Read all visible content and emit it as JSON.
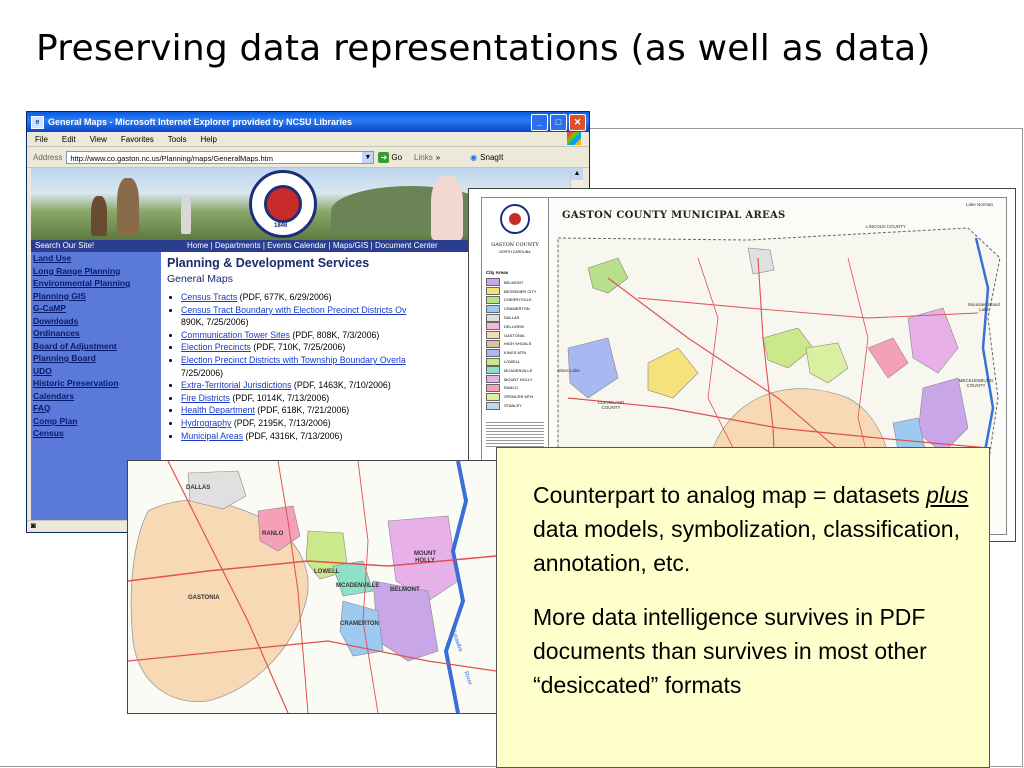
{
  "slide": {
    "title": "Preserving data representations (as well as data)"
  },
  "browser": {
    "window_title": "General Maps - Microsoft Internet Explorer provided by NCSU Libraries",
    "menu": [
      "File",
      "Edit",
      "View",
      "Favorites",
      "Tools",
      "Help"
    ],
    "address_label": "Address",
    "address_value": "http://www.co.gaston.nc.us/Planning/maps/GeneralMaps.htm",
    "go_label": "Go",
    "links_label": "Links",
    "snagit_label": "SnagIt"
  },
  "website": {
    "search_label": "Search Our Site!",
    "top_links": "Home | Departments | Events Calendar | Maps/GIS | Document Center",
    "seal_year": "1846",
    "nav_items": [
      "Land Use",
      "Long Range Planning",
      "Environmental Planning",
      "Planning GIS",
      "G-CaMP",
      "Downloads",
      "Ordinances",
      "Board of Adjustment",
      "Planning Board",
      "UDO",
      "Historic Preservation",
      "Calendars",
      "FAQ",
      "Comp Plan",
      "Census"
    ],
    "heading": "Planning & Development Services",
    "subheading": "General Maps",
    "maps": [
      {
        "link": "Census Tracts",
        "info": " (PDF, 677K, 6/29/2006)"
      },
      {
        "link": "Census Tract Boundary with Election Precinct Districts Ov",
        "info": "",
        "cont": "890K, 7/25/2006)"
      },
      {
        "link": "Communication Tower Sites",
        "info": " (PDF, 808K, 7/3/2006)"
      },
      {
        "link": "Election Precincts",
        "info": " (PDF, 710K, 7/25/2006)"
      },
      {
        "link": "Election Precinct Districts with Township Boundary Overla",
        "info": "",
        "cont": "7/25/2006)"
      },
      {
        "link": "Extra-Territorial Jurisdictions",
        "info": " (PDF, 1463K, 7/10/2006)"
      },
      {
        "link": "Fire Districts",
        "info": " (PDF, 1014K, 7/13/2006)"
      },
      {
        "link": "Health Department",
        "info": " (PDF, 618K, 7/21/2006)"
      },
      {
        "link": "Hydrography",
        "info": " (PDF, 2195K, 7/13/2006)"
      },
      {
        "link": "Municipal Areas",
        "info": " (PDF, 4316K, 7/13/2006)"
      }
    ]
  },
  "municipal_map": {
    "title": "GASTON COUNTY MUNICIPAL AREAS",
    "county_name": "GASTON COUNTY",
    "state": "NORTH CAROLINA",
    "legend_header": "City Areas",
    "legend": [
      {
        "name": "BELMONT",
        "color": "#c9a6e8"
      },
      {
        "name": "BESSEMER CITY",
        "color": "#f6e27a"
      },
      {
        "name": "CHERRYVILLE",
        "color": "#b8e08a"
      },
      {
        "name": "CRAMERTON",
        "color": "#9ec9f0"
      },
      {
        "name": "DALLAS",
        "color": "#e0e0e0"
      },
      {
        "name": "DELLVIEW",
        "color": "#f2b8d6"
      },
      {
        "name": "GASTONIA",
        "color": "#f7d9b5"
      },
      {
        "name": "HIGH SHOALS",
        "color": "#d9c2a0"
      },
      {
        "name": "KINGS MTN",
        "color": "#a8b8f0"
      },
      {
        "name": "LOWELL",
        "color": "#cbe88a"
      },
      {
        "name": "MCADENVILLE",
        "color": "#8fe0c8"
      },
      {
        "name": "MOUNT HOLLY",
        "color": "#e8b0e8"
      },
      {
        "name": "RANLO",
        "color": "#f4a0b8"
      },
      {
        "name": "SPENCER MTN",
        "color": "#d8f0a0"
      },
      {
        "name": "STANLEY",
        "color": "#c0d8e8"
      }
    ],
    "place_labels": {
      "lake_norman": "Lake Norman",
      "lincoln": "LINCOLN COUNTY",
      "mountain_island": "Mountain Island Lake",
      "mecklenburg": "MECKLENBURG COUNTY",
      "cleveland": "CLEVELAND COUNTY",
      "moss_lake": "Moss Lake"
    }
  },
  "zoom_map": {
    "labels": {
      "dallas": "DALLAS",
      "ranlo": "RANLO",
      "lowell": "LOWELL",
      "mcadenville": "MCADENVILLE",
      "gastonia": "GASTONIA",
      "mount_holly": "MOUNT HOLLY",
      "belmont": "BELMONT",
      "cramerton": "CRAMERTON",
      "catawba": "Catawba",
      "river": "River"
    }
  },
  "callout": {
    "p1_before": "Counterpart to analog map = datasets ",
    "p1_emph": "plus",
    "p1_after": " data models, symbolization, classification, annotation, etc.",
    "p2": "More data intelligence survives in PDF documents than survives in most other “desiccated” formats"
  },
  "colors": {
    "ie_titlebar": "#0a5be0",
    "site_nav": "#5b79d9",
    "callout_bg": "#ffffcc",
    "road": "#e05050",
    "river": "#3a6fd8",
    "gastonia": "#f7d9b5"
  }
}
